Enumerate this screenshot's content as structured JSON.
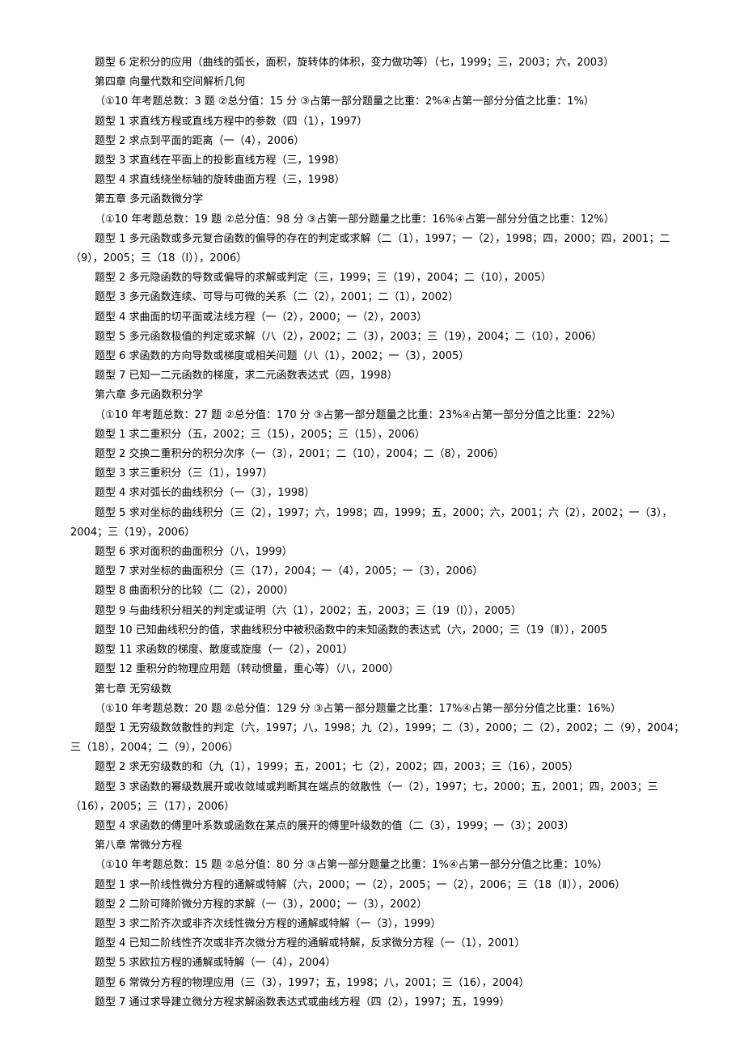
{
  "document": {
    "lines": [
      {
        "type": "item",
        "text": "题型 6  定积分的应用（曲线的弧长，面积，旋转体的体积，变力做功等）（七，1999；三，2003；六，2003）"
      },
      {
        "type": "chapter",
        "text": "第四章  向量代数和空间解析几何"
      },
      {
        "type": "stats",
        "text": "（①10 年考题总数：3 题  ②总分值：15 分  ③占第一部分题量之比重：2%④占第一部分分值之比重：1%）"
      },
      {
        "type": "item",
        "text": "题型  1  求直线方程或直线方程中的参数（四（1），1997）"
      },
      {
        "type": "item",
        "text": "题型 2    求点到平面的距离（一（4），2006）"
      },
      {
        "type": "item",
        "text": "题型  3  求直线在平面上的投影直线方程（三，1998）"
      },
      {
        "type": "item",
        "text": "题型 4  求直线绕坐标轴的旋转曲面方程（三，1998）"
      },
      {
        "type": "chapter",
        "text": "第五章  多元函数微分学"
      },
      {
        "type": "stats",
        "text": "（①10 年考题总数：19 题  ②总分值：98 分  ③占第一部分题量之比重：16%④占第一部分分值之比重：12%）"
      },
      {
        "type": "item",
        "text": "题型 1 多元函数或多元复合函数的偏导的存在的判定或求解（二（1），1997；一（2），1998；四，2000；四，2001；二（9），2005；三（18（Ⅰ）），2006）"
      },
      {
        "type": "item",
        "text": "题型  2  多元隐函数的导数或偏导的求解或判定（三，1999；三（19），2004；二（10），2005）"
      },
      {
        "type": "item",
        "text": "题型  3  多元函数连续、可导与可微的关系（二（2），2001；二（1），2002）"
      },
      {
        "type": "item",
        "text": "题型 4  求曲面的切平面或法线方程（一（2），2000；一（2），2003）"
      },
      {
        "type": "item",
        "text": "题型 5  多元函数极值的判定或求解（八（2），2002；二（3），2003；三（19），2004；二（10），2006）"
      },
      {
        "type": "item",
        "text": "题型  6  求函数的方向导数或梯度或相关问题（八（1），2002；一（3），2005）"
      },
      {
        "type": "item",
        "text": "题型 7  已知一二元函数的梯度，求二元函数表达式（四，1998）"
      },
      {
        "type": "chapter",
        "text": "第六章  多元函数积分学"
      },
      {
        "type": "stats",
        "text": "（①10 年考题总数：27 题  ②总分值：170 分  ③占第一部分题量之比重：23%④占第一部分分值之比重：22%）"
      },
      {
        "type": "item",
        "text": "题型  1  求二重积分（五，2002；三（15），2005；三（15），2006）"
      },
      {
        "type": "item",
        "text": "题型  2  交换二重积分的积分次序（一（3），2001；二（10），2004；二（8），2006）"
      },
      {
        "type": "item",
        "text": "题型  3  求三重积分（三（1），1997）"
      },
      {
        "type": "item",
        "text": "题型  4  求对弧长的曲线积分（一（3），1998）"
      },
      {
        "type": "item",
        "text": "题型 5 求对坐标的曲线积分（三（2），1997；六，1998；四，1999；五，2000；六，2001；六（2），2002；一（3），2004；三（19），2006）"
      },
      {
        "type": "item",
        "text": "题型  6  求对面积的曲面积分（八，1999）"
      },
      {
        "type": "item",
        "text": "题型  7  求对坐标的曲面积分（三（17），2004；一（4），2005；一（3），2006）"
      },
      {
        "type": "item",
        "text": "题型  8  曲面积分的比较（二（2），2000）"
      },
      {
        "type": "item",
        "text": "题型  9  与曲线积分相关的判定或证明（六（1），2002；五，2003；三（19（Ⅰ）），2005）"
      },
      {
        "type": "item",
        "text": "题型  10  已知曲线积分的值，求曲线积分中被积函数中的未知函数的表达式（六，2000；三（19（Ⅱ）），2005"
      },
      {
        "type": "item",
        "text": "题型  11  求函数的梯度、散度或旋度（一（2），2001）"
      },
      {
        "type": "item",
        "text": "题型  12  重积分的物理应用题（转动惯量，重心等）（八，2000）"
      },
      {
        "type": "chapter",
        "text": "第七章  无穷级数"
      },
      {
        "type": "stats",
        "text": "（①10 年考题总数：20 题  ②总分值：129 分  ③占第一部分题量之比重：17%④占第一部分分值之比重：16%）"
      },
      {
        "type": "item",
        "text": "题型 1 无穷级数敛散性的判定（六，1997；八，1998；九（2），1999；二（3），2000；二（2），2002；二（9），2004；三（18），2004；二（9），2006）"
      },
      {
        "type": "item",
        "text": "题型  2  求无穷级数的和（九（1），1999；五，2001；七（2），2002；四，2003；三（16），2005）"
      },
      {
        "type": "item",
        "text": "题型 3 求函数的幂级数展开或收敛域或判断其在端点的敛散性（一（2），1997；七，2000；五，2001；四，2003；三（16），2005；三（17），2006）"
      },
      {
        "type": "item",
        "text": "题型  4  求函数的傅里叶系数或函数在某点的展开的傅里叶级数的值（二（3），1999；一（3）；2003）"
      },
      {
        "type": "chapter",
        "text": "第八章  常微分方程"
      },
      {
        "type": "stats",
        "text": "（①10 年考题总数：15 题  ②总分值：80 分  ③占第一部分题量之比重：1%④占第一部分分值之比重：10%）"
      },
      {
        "type": "item",
        "text": "题型  1 求一阶线性微分方程的通解或特解（六，2000；一（2），2005；一（2），2006；三（18（Ⅱ）），2006）"
      },
      {
        "type": "item",
        "text": "题型  2  二阶可降阶微分方程的求解（一（3），2000；一（3），2002）"
      },
      {
        "type": "item",
        "text": "题型  3  求二阶齐次或非齐次线性微分方程的通解或特解（一（3），1999）"
      },
      {
        "type": "item",
        "text": "题型  4  已知二阶线性齐次或非齐次微分方程的通解或特解，反求微分方程（一（1），2001）"
      },
      {
        "type": "item",
        "text": "题型  5  求欧拉方程的通解或特解（一（4），2004）"
      },
      {
        "type": "item",
        "text": "题型  6  常微分方程的物理应用（三（3），1997；五，1998；八，2001；三（16），2004）"
      },
      {
        "type": "item",
        "text": "题型  7  通过求导建立微分方程求解函数表达式或曲线方程（四（2），1997；五，1999）"
      }
    ]
  }
}
